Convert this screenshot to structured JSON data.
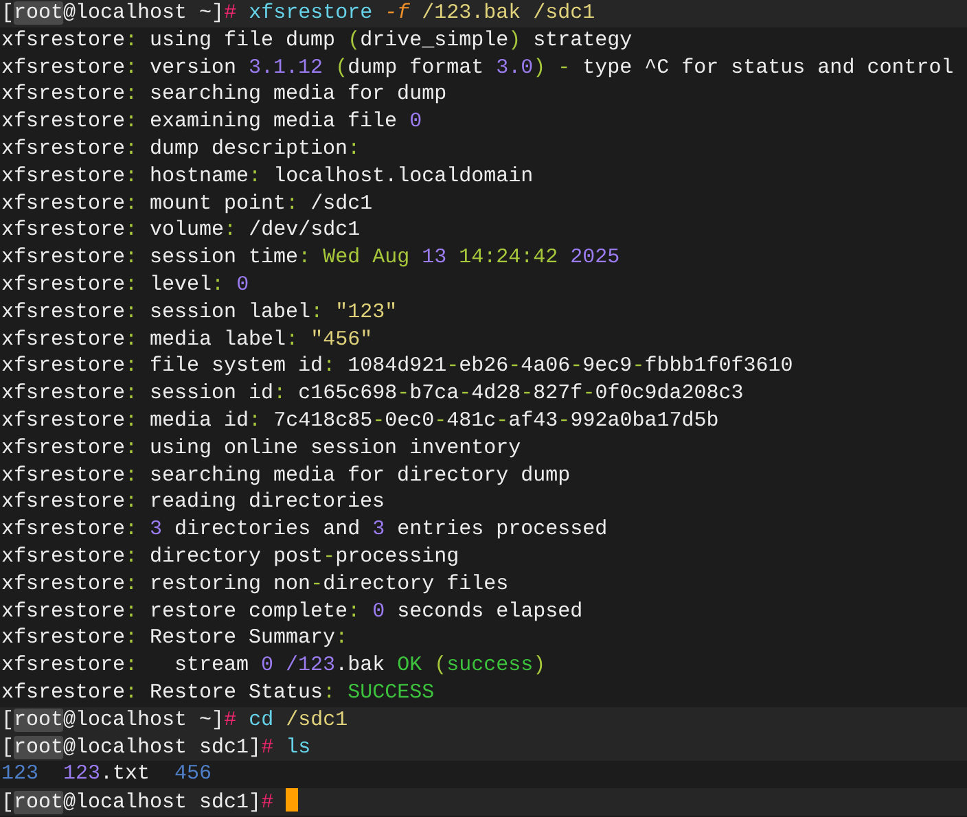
{
  "terminal": {
    "lines": [
      {
        "kind": "prompt",
        "cursor": false,
        "segments": [
          {
            "text": "["
          },
          {
            "text": "root",
            "highlighted": true
          },
          {
            "text": "@localhost ~]"
          },
          {
            "text": "# ",
            "color": "#f0266e"
          },
          {
            "text": "xfsrestore",
            "color": "#66d2e8"
          },
          {
            "text": " -f",
            "color": "#f0902a",
            "italic": true
          },
          {
            "text": " /123.bak /sdc1",
            "color": "#e0d27a"
          }
        ]
      },
      {
        "kind": "output",
        "segments": [
          {
            "text": "xfsrestore"
          },
          {
            "text": ":",
            "color": "#a8c83c"
          },
          {
            "text": " using file dump"
          },
          {
            "text": " (",
            "color": "#a8c83c"
          },
          {
            "text": "drive_simple"
          },
          {
            "text": ")",
            "color": "#a8c83c"
          },
          {
            "text": " strategy"
          }
        ]
      },
      {
        "kind": "output",
        "segments": [
          {
            "text": "xfsrestore"
          },
          {
            "text": ":",
            "color": "#a8c83c"
          },
          {
            "text": " version "
          },
          {
            "text": "3.1.12",
            "color": "#9a7cf0"
          },
          {
            "text": " (",
            "color": "#a8c83c"
          },
          {
            "text": "dump format "
          },
          {
            "text": "3.0",
            "color": "#9a7cf0"
          },
          {
            "text": ")",
            "color": "#a8c83c"
          },
          {
            "text": " -",
            "color": "#a8c83c"
          },
          {
            "text": " type ^C for status and control"
          }
        ]
      },
      {
        "kind": "output",
        "segments": [
          {
            "text": "xfsrestore"
          },
          {
            "text": ":",
            "color": "#a8c83c"
          },
          {
            "text": " searching media for dump"
          }
        ]
      },
      {
        "kind": "output",
        "segments": [
          {
            "text": "xfsrestore"
          },
          {
            "text": ":",
            "color": "#a8c83c"
          },
          {
            "text": " examining media file "
          },
          {
            "text": "0",
            "color": "#9a7cf0"
          }
        ]
      },
      {
        "kind": "output",
        "segments": [
          {
            "text": "xfsrestore"
          },
          {
            "text": ":",
            "color": "#a8c83c"
          },
          {
            "text": " dump description"
          },
          {
            "text": ":",
            "color": "#a8c83c"
          }
        ]
      },
      {
        "kind": "output",
        "segments": [
          {
            "text": "xfsrestore"
          },
          {
            "text": ":",
            "color": "#a8c83c"
          },
          {
            "text": " hostname"
          },
          {
            "text": ":",
            "color": "#a8c83c"
          },
          {
            "text": " localhost.localdomain"
          }
        ]
      },
      {
        "kind": "output",
        "segments": [
          {
            "text": "xfsrestore"
          },
          {
            "text": ":",
            "color": "#a8c83c"
          },
          {
            "text": " mount point"
          },
          {
            "text": ":",
            "color": "#a8c83c"
          },
          {
            "text": " /sdc1"
          }
        ]
      },
      {
        "kind": "output",
        "segments": [
          {
            "text": "xfsrestore"
          },
          {
            "text": ":",
            "color": "#a8c83c"
          },
          {
            "text": " volume"
          },
          {
            "text": ":",
            "color": "#a8c83c"
          },
          {
            "text": " /dev/sdc1"
          }
        ]
      },
      {
        "kind": "output",
        "segments": [
          {
            "text": "xfsrestore"
          },
          {
            "text": ":",
            "color": "#a8c83c"
          },
          {
            "text": " session time"
          },
          {
            "text": ": Wed Aug ",
            "color": "#a8c83c"
          },
          {
            "text": "13",
            "color": "#9a7cf0"
          },
          {
            "text": " 14:24:42 ",
            "color": "#a8c83c"
          },
          {
            "text": "2025",
            "color": "#9a7cf0"
          }
        ]
      },
      {
        "kind": "output",
        "segments": [
          {
            "text": "xfsrestore"
          },
          {
            "text": ":",
            "color": "#a8c83c"
          },
          {
            "text": " level"
          },
          {
            "text": ": ",
            "color": "#a8c83c"
          },
          {
            "text": "0",
            "color": "#9a7cf0"
          }
        ]
      },
      {
        "kind": "output",
        "segments": [
          {
            "text": "xfsrestore"
          },
          {
            "text": ":",
            "color": "#a8c83c"
          },
          {
            "text": " session label"
          },
          {
            "text": ": ",
            "color": "#a8c83c"
          },
          {
            "text": "\"123\"",
            "color": "#e0d27a"
          }
        ]
      },
      {
        "kind": "output",
        "segments": [
          {
            "text": "xfsrestore"
          },
          {
            "text": ":",
            "color": "#a8c83c"
          },
          {
            "text": " media label"
          },
          {
            "text": ": ",
            "color": "#a8c83c"
          },
          {
            "text": "\"456\"",
            "color": "#e0d27a"
          }
        ]
      },
      {
        "kind": "output",
        "segments": [
          {
            "text": "xfsrestore"
          },
          {
            "text": ":",
            "color": "#a8c83c"
          },
          {
            "text": " file system id"
          },
          {
            "text": ":",
            "color": "#a8c83c"
          },
          {
            "text": " 1084d921"
          },
          {
            "text": "-",
            "color": "#a8c83c"
          },
          {
            "text": "eb26"
          },
          {
            "text": "-",
            "color": "#a8c83c"
          },
          {
            "text": "4a06"
          },
          {
            "text": "-",
            "color": "#a8c83c"
          },
          {
            "text": "9ec9"
          },
          {
            "text": "-",
            "color": "#a8c83c"
          },
          {
            "text": "fbbb1f0f3610"
          }
        ]
      },
      {
        "kind": "output",
        "segments": [
          {
            "text": "xfsrestore"
          },
          {
            "text": ":",
            "color": "#a8c83c"
          },
          {
            "text": " session id"
          },
          {
            "text": ":",
            "color": "#a8c83c"
          },
          {
            "text": " c165c698"
          },
          {
            "text": "-",
            "color": "#a8c83c"
          },
          {
            "text": "b7ca"
          },
          {
            "text": "-",
            "color": "#a8c83c"
          },
          {
            "text": "4d28"
          },
          {
            "text": "-",
            "color": "#a8c83c"
          },
          {
            "text": "827f"
          },
          {
            "text": "-",
            "color": "#a8c83c"
          },
          {
            "text": "0f0c9da208c3"
          }
        ]
      },
      {
        "kind": "output",
        "segments": [
          {
            "text": "xfsrestore"
          },
          {
            "text": ":",
            "color": "#a8c83c"
          },
          {
            "text": " media id"
          },
          {
            "text": ":",
            "color": "#a8c83c"
          },
          {
            "text": " 7c418c85"
          },
          {
            "text": "-",
            "color": "#a8c83c"
          },
          {
            "text": "0ec0"
          },
          {
            "text": "-",
            "color": "#a8c83c"
          },
          {
            "text": "481c"
          },
          {
            "text": "-",
            "color": "#a8c83c"
          },
          {
            "text": "af43"
          },
          {
            "text": "-",
            "color": "#a8c83c"
          },
          {
            "text": "992a0ba17d5b"
          }
        ]
      },
      {
        "kind": "output",
        "segments": [
          {
            "text": "xfsrestore"
          },
          {
            "text": ":",
            "color": "#a8c83c"
          },
          {
            "text": " using online session inventory"
          }
        ]
      },
      {
        "kind": "output",
        "segments": [
          {
            "text": "xfsrestore"
          },
          {
            "text": ":",
            "color": "#a8c83c"
          },
          {
            "text": " searching media for directory dump"
          }
        ]
      },
      {
        "kind": "output",
        "segments": [
          {
            "text": "xfsrestore"
          },
          {
            "text": ":",
            "color": "#a8c83c"
          },
          {
            "text": " reading directories"
          }
        ]
      },
      {
        "kind": "output",
        "segments": [
          {
            "text": "xfsrestore"
          },
          {
            "text": ": ",
            "color": "#a8c83c"
          },
          {
            "text": "3",
            "color": "#9a7cf0"
          },
          {
            "text": " directories and "
          },
          {
            "text": "3",
            "color": "#9a7cf0"
          },
          {
            "text": " entries processed"
          }
        ]
      },
      {
        "kind": "output",
        "segments": [
          {
            "text": "xfsrestore"
          },
          {
            "text": ":",
            "color": "#a8c83c"
          },
          {
            "text": " directory post"
          },
          {
            "text": "-",
            "color": "#a8c83c"
          },
          {
            "text": "processing"
          }
        ]
      },
      {
        "kind": "output",
        "segments": [
          {
            "text": "xfsrestore"
          },
          {
            "text": ":",
            "color": "#a8c83c"
          },
          {
            "text": " restoring non"
          },
          {
            "text": "-",
            "color": "#a8c83c"
          },
          {
            "text": "directory files"
          }
        ]
      },
      {
        "kind": "output",
        "segments": [
          {
            "text": "xfsrestore"
          },
          {
            "text": ":",
            "color": "#a8c83c"
          },
          {
            "text": " restore complete"
          },
          {
            "text": ": ",
            "color": "#a8c83c"
          },
          {
            "text": "0",
            "color": "#9a7cf0"
          },
          {
            "text": " seconds elapsed"
          }
        ]
      },
      {
        "kind": "output",
        "segments": [
          {
            "text": "xfsrestore"
          },
          {
            "text": ":",
            "color": "#a8c83c"
          },
          {
            "text": " Restore Summary"
          },
          {
            "text": ":",
            "color": "#a8c83c"
          }
        ]
      },
      {
        "kind": "output",
        "segments": [
          {
            "text": "xfsrestore"
          },
          {
            "text": ":",
            "color": "#a8c83c"
          },
          {
            "text": "   stream "
          },
          {
            "text": "0 /123",
            "color": "#9a7cf0"
          },
          {
            "text": ".bak "
          },
          {
            "text": "OK",
            "color": "#3cc23c"
          },
          {
            "text": " (",
            "color": "#a8c83c"
          },
          {
            "text": "success",
            "color": "#3cc23c"
          },
          {
            "text": ")",
            "color": "#a8c83c"
          }
        ]
      },
      {
        "kind": "output",
        "segments": [
          {
            "text": "xfsrestore"
          },
          {
            "text": ":",
            "color": "#a8c83c"
          },
          {
            "text": " Restore Status"
          },
          {
            "text": ": ",
            "color": "#a8c83c"
          },
          {
            "text": "SUCCESS",
            "color": "#3cc23c"
          }
        ]
      },
      {
        "kind": "prompt",
        "cursor": false,
        "segments": [
          {
            "text": "["
          },
          {
            "text": "root",
            "highlighted": true
          },
          {
            "text": "@localhost ~]"
          },
          {
            "text": "# ",
            "color": "#f0266e"
          },
          {
            "text": "cd",
            "color": "#66d2e8"
          },
          {
            "text": " /sdc1",
            "color": "#e0d27a"
          }
        ]
      },
      {
        "kind": "prompt",
        "cursor": false,
        "segments": [
          {
            "text": "["
          },
          {
            "text": "root",
            "highlighted": true
          },
          {
            "text": "@localhost sdc1]"
          },
          {
            "text": "# ",
            "color": "#f0266e"
          },
          {
            "text": "ls",
            "color": "#66d2e8"
          }
        ]
      },
      {
        "kind": "output",
        "segments": [
          {
            "text": "123",
            "color": "#4f7fc8"
          },
          {
            "text": "  123",
            "color": "#9a7cf0"
          },
          {
            "text": ".txt  "
          },
          {
            "text": "456",
            "color": "#4f7fc8"
          }
        ]
      },
      {
        "kind": "prompt",
        "cursor": true,
        "segments": [
          {
            "text": "["
          },
          {
            "text": "root",
            "highlighted": true
          },
          {
            "text": "@localhost sdc1]"
          },
          {
            "text": "# ",
            "color": "#f0266e"
          }
        ]
      }
    ]
  }
}
